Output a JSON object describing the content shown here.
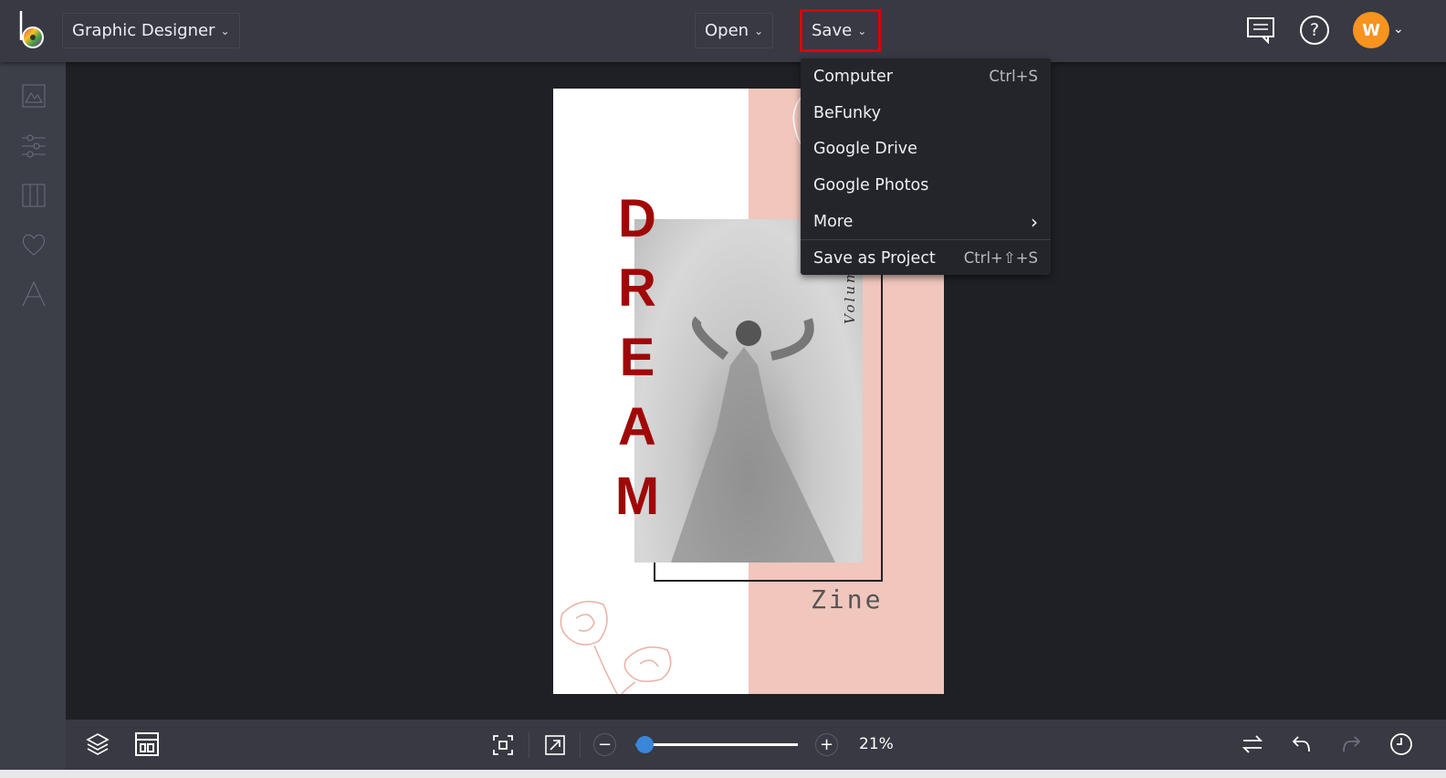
{
  "header": {
    "app_menu": "Graphic Designer",
    "open_label": "Open",
    "save_label": "Save",
    "avatar_initial": "W"
  },
  "save_menu": {
    "items": [
      {
        "label": "Computer",
        "shortcut": "Ctrl+S"
      },
      {
        "label": "BeFunky",
        "shortcut": ""
      },
      {
        "label": "Google Drive",
        "shortcut": ""
      },
      {
        "label": "Google Photos",
        "shortcut": ""
      },
      {
        "label": "More",
        "shortcut": "›"
      },
      {
        "label": "Save as Project",
        "shortcut": "Ctrl+⇧+S"
      }
    ]
  },
  "sidebar": {
    "items": [
      "image-manager",
      "edit",
      "layouts",
      "graphics",
      "text"
    ]
  },
  "canvas": {
    "letters": [
      "D",
      "R",
      "E",
      "A",
      "M"
    ],
    "subtitle": "Zine",
    "vertical_text": "Volume"
  },
  "footer": {
    "zoom_label": "21%",
    "zoom_value": 21
  },
  "colors": {
    "accent": "#3a86d8",
    "highlight": "#e00000",
    "avatar": "#f7931e",
    "title_red": "#a00808"
  }
}
